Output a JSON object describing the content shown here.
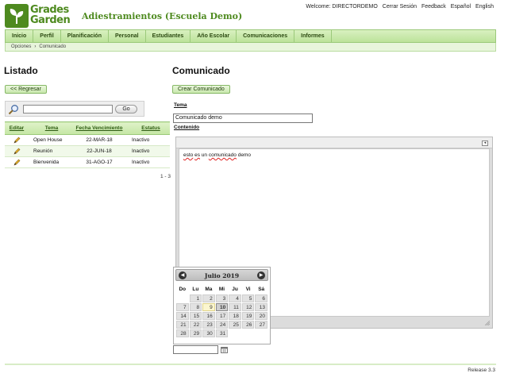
{
  "header": {
    "logo_line1": "Grades",
    "logo_line2": "Garden",
    "school_title": "Adiestramientos (Escuela Demo)",
    "welcome": "Welcome: DIRECTORDEMO",
    "logout": "Cerrar Sesión",
    "feedback": "Feedback",
    "lang_es": "Español",
    "lang_en": "English"
  },
  "nav": [
    "Inicio",
    "Perfil",
    "Planificación",
    "Personal",
    "Estudiantes",
    "Año Escolar",
    "Comunicaciones",
    "Informes"
  ],
  "breadcrumb": {
    "parent": "Opciones",
    "separator": "›",
    "current": "Comunicado"
  },
  "listado": {
    "title": "Listado",
    "back_button": "<< Regresar",
    "search_value": "",
    "go_button": "Go",
    "columns": {
      "edit": "Editar",
      "tema": "Tema",
      "fecha": "Fecha Vencimiento",
      "estatus": "Estatus"
    },
    "rows": [
      {
        "tema": "Open House",
        "fecha": "22-MAR-18",
        "estatus": "Inactivo"
      },
      {
        "tema": "Reunión",
        "fecha": "22-JUN-18",
        "estatus": "Inactivo"
      },
      {
        "tema": "Bienvenida",
        "fecha": "31-AGO-17",
        "estatus": "Inactivo"
      }
    ],
    "pager": "1 - 3"
  },
  "comunicado": {
    "title": "Comunicado",
    "create_button": "Crear Comunicado",
    "tema_label": "Tema",
    "tema_value": "Comunicado demo",
    "contenido_label": "Contenido",
    "content_words": [
      "esto",
      "es",
      "un",
      "comunicado",
      "demo"
    ]
  },
  "datepicker": {
    "month_year": "Julio 2019",
    "prev": "◀",
    "next": "▶",
    "weekdays": [
      "Do",
      "Lu",
      "Ma",
      "Mi",
      "Ju",
      "Vi",
      "Sá"
    ],
    "weeks": [
      [
        "",
        "1",
        "2",
        "3",
        "4",
        "5",
        "6"
      ],
      [
        "7",
        "8",
        "9",
        "10",
        "11",
        "12",
        "13"
      ],
      [
        "14",
        "15",
        "16",
        "17",
        "18",
        "19",
        "20"
      ],
      [
        "21",
        "22",
        "23",
        "24",
        "25",
        "26",
        "27"
      ],
      [
        "28",
        "29",
        "30",
        "31",
        "",
        "",
        ""
      ]
    ],
    "today": "9",
    "selected": "10"
  },
  "footer": {
    "release": "Release 3.3"
  },
  "colors": {
    "brand_green": "#4e8a1f",
    "nav_bg": "#c4e6a4"
  }
}
